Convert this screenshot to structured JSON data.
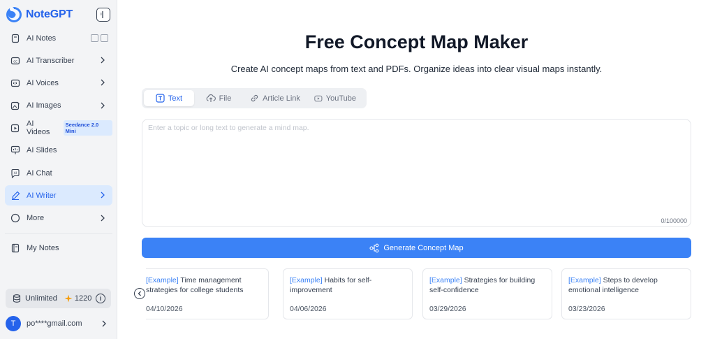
{
  "brand": {
    "name": "NoteGPT"
  },
  "sidebar": {
    "items": [
      {
        "label": "AI Notes",
        "icon": "notebook-icon"
      },
      {
        "label": "AI Transcriber",
        "icon": "captions-icon"
      },
      {
        "label": "AI Voices",
        "icon": "waveform-icon"
      },
      {
        "label": "AI Images",
        "icon": "image-edit-icon"
      },
      {
        "label": "AI Videos",
        "icon": "video-icon",
        "badge": "Seedance 2.0 Mini"
      },
      {
        "label": "AI Slides",
        "icon": "slides-icon"
      },
      {
        "label": "AI Chat",
        "icon": "ai-chat-icon"
      },
      {
        "label": "AI Writer",
        "icon": "pen-icon",
        "active": true
      },
      {
        "label": "More",
        "icon": "more-circle-icon"
      }
    ],
    "my_notes": "My Notes",
    "quota": {
      "plan": "Unlimited",
      "credits": "1220"
    },
    "user": {
      "initial": "T",
      "email": "po****gmail.com"
    }
  },
  "main": {
    "title": "Free Concept Map Maker",
    "subtitle": "Create AI concept maps from text and PDFs. Organize ideas into clear visual maps instantly.",
    "tabs": [
      {
        "label": "Text",
        "active": true
      },
      {
        "label": "File"
      },
      {
        "label": "Article Link"
      },
      {
        "label": "YouTube"
      }
    ],
    "input": {
      "placeholder": "Enter a topic or long text to generate a mind map.",
      "value": "",
      "counter": "0/100000"
    },
    "generate_label": "Generate Concept Map",
    "examples": [
      {
        "tag": "[Example]",
        "text": " Time management strategies for college students",
        "date": "04/10/2026"
      },
      {
        "tag": "[Example]",
        "text": " Habits for self-improvement",
        "date": "04/06/2026"
      },
      {
        "tag": "[Example]",
        "text": " Strategies for building self-confidence",
        "date": "03/29/2026"
      },
      {
        "tag": "[Example]",
        "text": " Steps to develop emotional intelligence",
        "date": "03/23/2026"
      }
    ]
  },
  "colors": {
    "accent": "#3b82f6",
    "active_bg": "#dbeafe",
    "brand": "#2563eb"
  }
}
